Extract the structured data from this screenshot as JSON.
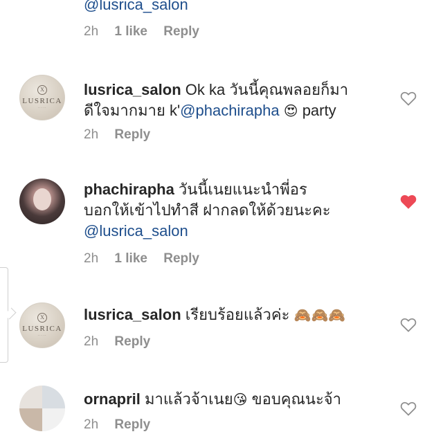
{
  "top_comment": {
    "mention": "@lusrica_salon",
    "time": "2h",
    "likes": "1 like",
    "reply": "Reply"
  },
  "comments": [
    {
      "user": "lusrica_salon",
      "text_line1": " Ok ka วันนี้คุณพลอยก็มา",
      "text_line2_before": "ดีใจมากมาย k'",
      "mention": "@phachirapha",
      "emoji": "😍",
      "text_line2_after": " party",
      "time": "2h",
      "reply": "Reply",
      "liked": false,
      "avatar_logo": "LUSRICA"
    },
    {
      "user": "phachirapha",
      "text_line1": " วันนี้เนยแนะนำพี่อร",
      "text_line2": "บอกให้เข้าไปทำสี ฝากลดให้ด้วยนะคะ",
      "mention": "@lusrica_salon",
      "time": "2h",
      "likes": "1 like",
      "reply": "Reply",
      "liked": true
    },
    {
      "user": "lusrica_salon",
      "text_line1": " เรียบร้อยแล้วค่ะ",
      "emoji": "🙈🙈🙈",
      "time": "2h",
      "reply": "Reply",
      "liked": false,
      "avatar_logo": "LUSRICA"
    },
    {
      "user": "ornapril",
      "text_line1": " มาแล้วจ้าเนย",
      "emoji": "😘",
      "text_after": " ขอบคุณนะจ้า",
      "time": "2h",
      "reply": "Reply",
      "liked": false
    }
  ],
  "colors": {
    "text": "#262626",
    "meta": "#8e8e8e",
    "mention": "#1e4e8c",
    "heart_liked": "#ed4956"
  }
}
